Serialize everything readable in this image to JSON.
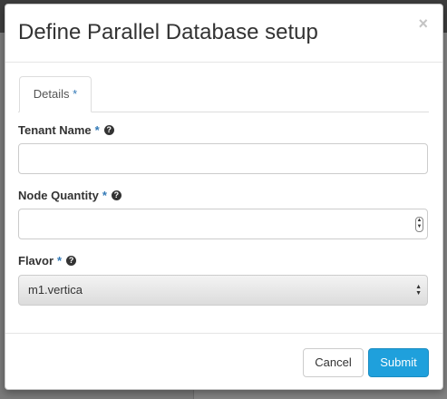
{
  "modal": {
    "title": "Define Parallel Database setup",
    "close_label": "×"
  },
  "tabs": [
    {
      "label": "Details",
      "required_mark": "*"
    }
  ],
  "fields": {
    "tenant_name": {
      "label": "Tenant Name",
      "required_mark": "*",
      "help": "?",
      "value": ""
    },
    "node_quantity": {
      "label": "Node Quantity",
      "required_mark": "*",
      "help": "?",
      "value": ""
    },
    "flavor": {
      "label": "Flavor",
      "required_mark": "*",
      "help": "?",
      "selected": "m1.vertica"
    }
  },
  "footer": {
    "cancel_label": "Cancel",
    "submit_label": "Submit"
  },
  "colors": {
    "accent": "#1fa0dc",
    "required": "#337ab7"
  },
  "icons": {
    "close": "close-icon",
    "help": "help-icon",
    "spinner": "number-spinner-icon",
    "select": "select-arrows-icon"
  }
}
